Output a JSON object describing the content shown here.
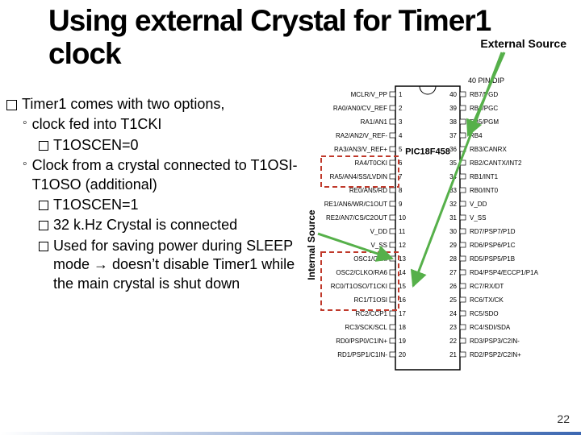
{
  "title": "Using external Crystal for Timer1 clock",
  "external_label": "External Source",
  "internal_label": "Internal Source",
  "page_number": "22",
  "body": {
    "l0": "Timer1 comes with two options,",
    "l1a": "clock fed into T1CKI",
    "l2a": "T1OSCEN=0",
    "l1b": "Clock from a crystal connected to T1OSI-T1OSO (additional)",
    "l2b": "T1OSCEN=1",
    "l2c": "32 k.Hz Crystal is connected",
    "l2d": "Used for saving power during SLEEP mode → doesn’t disable Timer1 while the main crystal is shut down"
  },
  "chip": {
    "header": "40 PIN DIP",
    "center": "PIC18F458",
    "left": [
      "MCLR/V_PP",
      "RA0/AN0/CV_REF",
      "RA1/AN1",
      "RA2/AN2/V_REF-",
      "RA3/AN3/V_REF+",
      "RA4/T0CKI",
      "RA5/AN4/SS/LVDIN",
      "RE0/AN5/RD",
      "RE1/AN6/WR/C1OUT",
      "RE2/AN7/CS/C2OUT",
      "V_DD",
      "V_SS",
      "OSC1/CLKI",
      "OSC2/CLKO/RA6",
      "RC0/T1OSO/T1CKI",
      "RC1/T1OSI",
      "RC2/CCP1",
      "RC3/SCK/SCL",
      "RD0/PSP0/C1IN+",
      "RD1/PSP1/C1IN-"
    ],
    "right": [
      "RB7/PGD",
      "RB6/PGC",
      "RB5/PGM",
      "RB4",
      "RB3/CANRX",
      "RB2/CANTX/INT2",
      "RB1/INT1",
      "RB0/INT0",
      "V_DD",
      "V_SS",
      "RD7/PSP7/P1D",
      "RD6/PSP6/P1C",
      "RD5/PSP5/P1B",
      "RD4/PSP4/ECCP1/P1A",
      "RC7/RX/DT",
      "RC6/TX/CK",
      "RC5/SDO",
      "RC4/SDI/SDA",
      "RD3/PSP3/C2IN-",
      "RD2/PSP2/C2IN+"
    ]
  },
  "colors": {
    "arrow_green": "#56b04a",
    "dash_red": "#c0392b"
  }
}
